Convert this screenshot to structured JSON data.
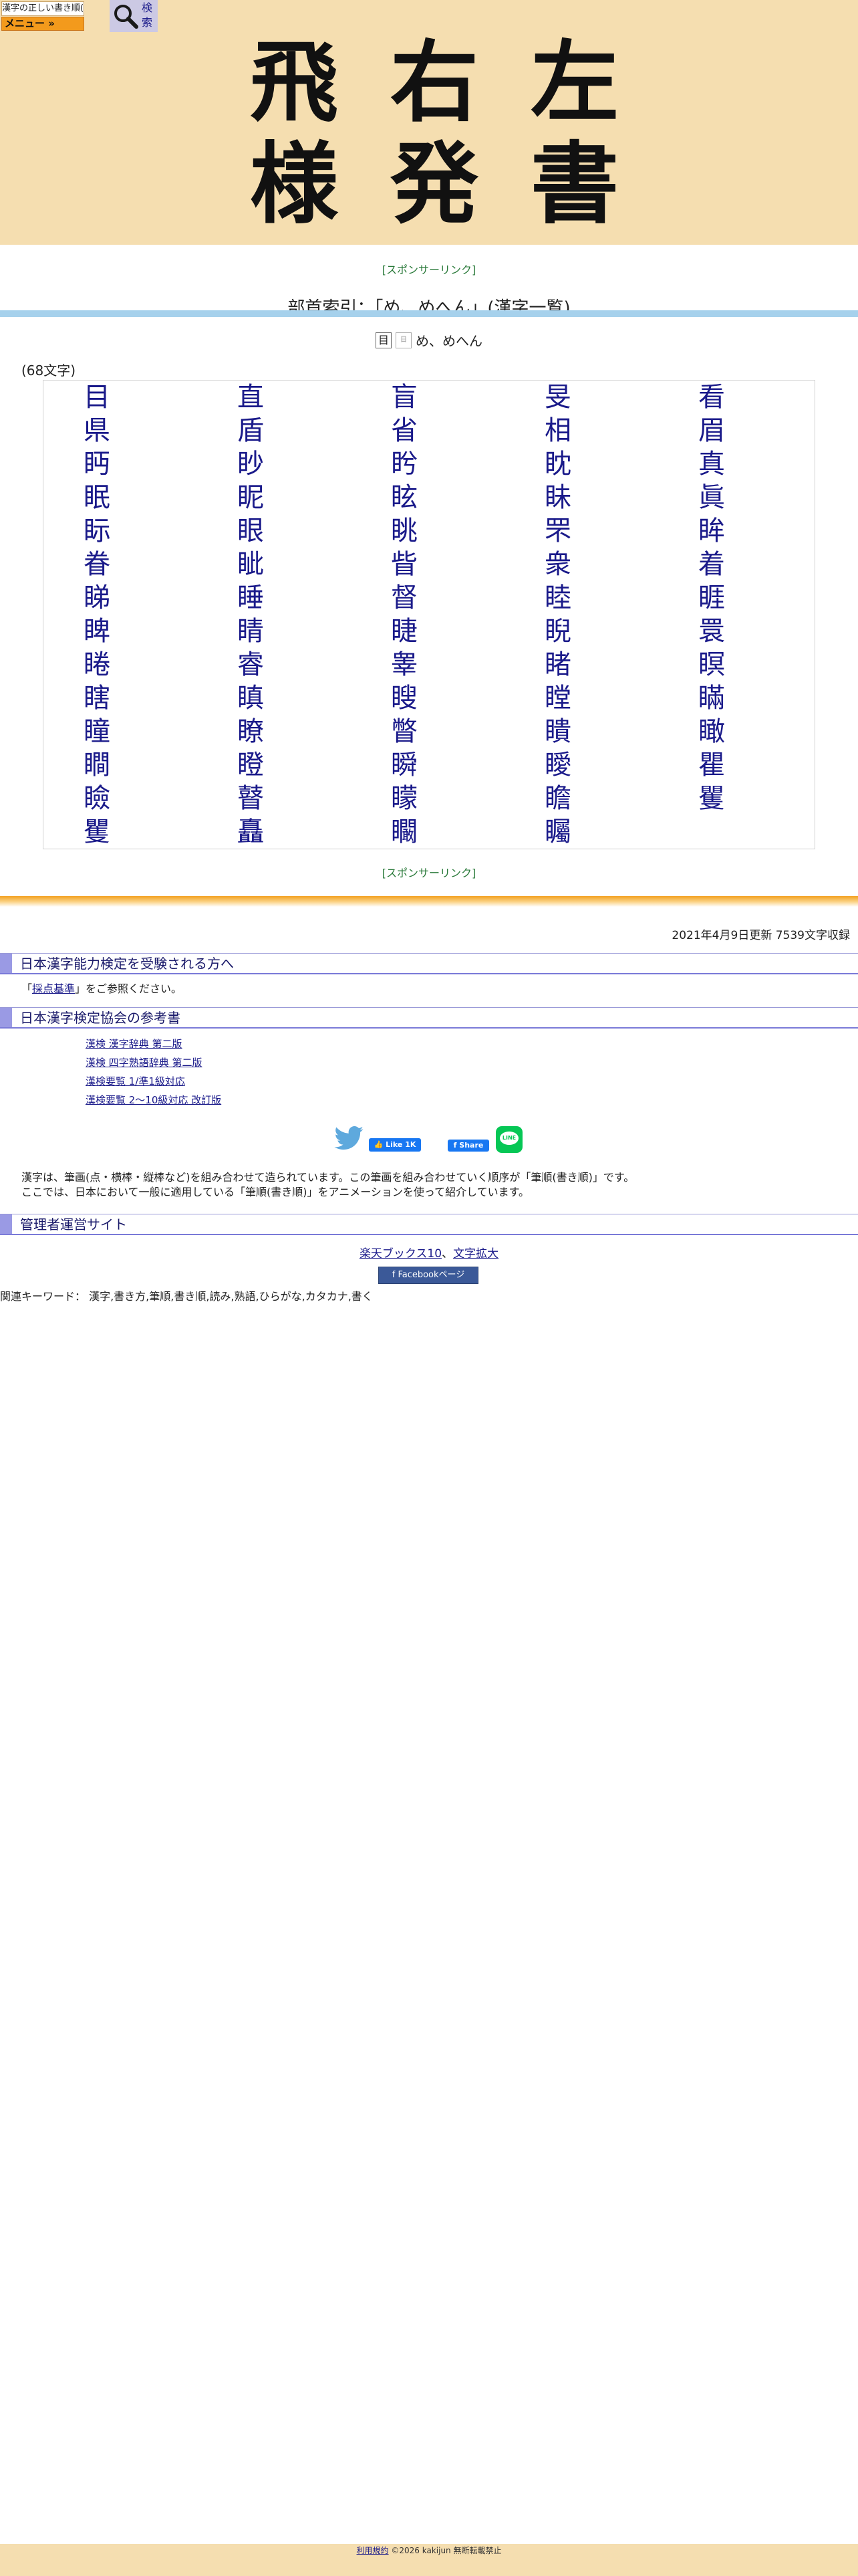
{
  "header": {
    "logo_text": "漢字の正しい書き順(筆順)",
    "menu_label": "メニュー »",
    "search_label": "検索",
    "title_chars": [
      "飛",
      "右",
      "左",
      "様",
      "発",
      "書"
    ]
  },
  "sponsor_label": "[スポンサーリンク]",
  "page_heading": "部首索引：「め、めへん」(漢字一覧)",
  "radical": {
    "icon1": "目",
    "icon2": "目",
    "name": "め、めへん"
  },
  "char_count": "(68文字)",
  "kanji": [
    "目",
    "直",
    "盲",
    "旻",
    "看",
    "県",
    "盾",
    "省",
    "相",
    "眉",
    "眄",
    "眇",
    "盻",
    "眈",
    "真",
    "眠",
    "眤",
    "眩",
    "眛",
    "眞",
    "眎",
    "眼",
    "眺",
    "罘",
    "眸",
    "眷",
    "眦",
    "眥",
    "衆",
    "着",
    "睇",
    "睡",
    "督",
    "睦",
    "睚",
    "睥",
    "睛",
    "睫",
    "睨",
    "睘",
    "睠",
    "睿",
    "睾",
    "睹",
    "瞑",
    "瞎",
    "瞋",
    "瞍",
    "瞠",
    "瞞",
    "瞳",
    "瞭",
    "瞥",
    "瞶",
    "瞰",
    "瞷",
    "瞪",
    "瞬",
    "瞹",
    "瞿",
    "瞼",
    "瞽",
    "矇",
    "瞻",
    "矍",
    "矍",
    "矗",
    "矙",
    "矚"
  ],
  "update_info": "2021年4月9日更新 7539文字収録",
  "sections": {
    "kentei_title": "日本漢字能力検定を受験される方へ",
    "kentei_text_before": "「",
    "kentei_link": "採点基準",
    "kentei_text_after": "」をご参照ください。",
    "books_title": "日本漢字検定協会の参考書",
    "books": [
      "漢検 漢字辞典 第二版",
      "漢検 四字熟語辞典 第二版",
      "漢検要覧 1/準1級対応",
      "漢検要覧 2～10級対応 改訂版"
    ],
    "admin_title": "管理者運営サイト"
  },
  "social": {
    "fb_like": "Like 1K",
    "fb_share": "Share",
    "line_label": "LINE"
  },
  "description": {
    "line1": "漢字は、筆画(点・横棒・縦棒など)を組み合わせて造られています。この筆画を組み合わせていく順序が「筆順(書き順)」です。",
    "line2": "ここでは、日本において一般に適用している「筆順(書き順)」をアニメーションを使って紹介しています。"
  },
  "admin_links": {
    "link1": "楽天ブックス10",
    "sep": "、",
    "link2": "文字拡大"
  },
  "fb_page_label": "Facebookページ",
  "keywords": "関連キーワード： 漢字,書き方,筆順,書き順,読み,熟語,ひらがな,カタカナ,書く",
  "footer": {
    "terms": "利用規約",
    "copyright": "©2026 kakijun 無断転載禁止"
  }
}
